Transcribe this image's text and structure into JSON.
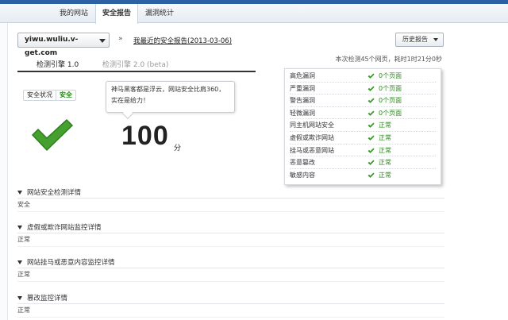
{
  "nav": {
    "items": [
      {
        "label": "我的网站"
      },
      {
        "label": "安全报告"
      },
      {
        "label": "漏洞统计"
      }
    ]
  },
  "header": {
    "domain": "yiwu.wuliu.v-get.com",
    "separator": "»",
    "report_link": "我最近的安全报告(2013-03-06)",
    "history_button": "历史报告"
  },
  "tabs": [
    {
      "label": "检测引擎 1.0"
    },
    {
      "label": "检测引擎 2.0 (beta)"
    }
  ],
  "scan_info": "本次检测45个网页，耗时1时21分0秒",
  "status": {
    "label": "安全状况",
    "value": "安全"
  },
  "bubble": {
    "line1": "神马黑客都是浮云，网站安全比肩360，",
    "line2": "实在是给力！"
  },
  "score": {
    "value": "100",
    "unit": "分"
  },
  "results": [
    {
      "name": "高危漏洞",
      "value": "0个页面"
    },
    {
      "name": "严重漏洞",
      "value": "0个页面"
    },
    {
      "name": "警告漏洞",
      "value": "0个页面"
    },
    {
      "name": "轻微漏洞",
      "value": "0个页面"
    },
    {
      "name": "同主机网站安全",
      "value": "正常"
    },
    {
      "name": "虚假或欺诈网站",
      "value": "正常"
    },
    {
      "name": "挂马或恶意网站",
      "value": "正常"
    },
    {
      "name": "恶意篡改",
      "value": "正常"
    },
    {
      "name": "敏感内容",
      "value": "正常"
    }
  ],
  "sections": [
    {
      "title": "网站安全检测详情",
      "body": "安全"
    },
    {
      "title": "虚假或欺诈网站监控详情",
      "body": "正常"
    },
    {
      "title": "网站挂马或恶意内容监控详情",
      "body": "正常"
    },
    {
      "title": "篡改监控详情",
      "body": "正常"
    }
  ],
  "colors": {
    "accent": "#2c61a3",
    "safe_green": "#2a8a1a",
    "check_green": "#3a9a2a"
  }
}
